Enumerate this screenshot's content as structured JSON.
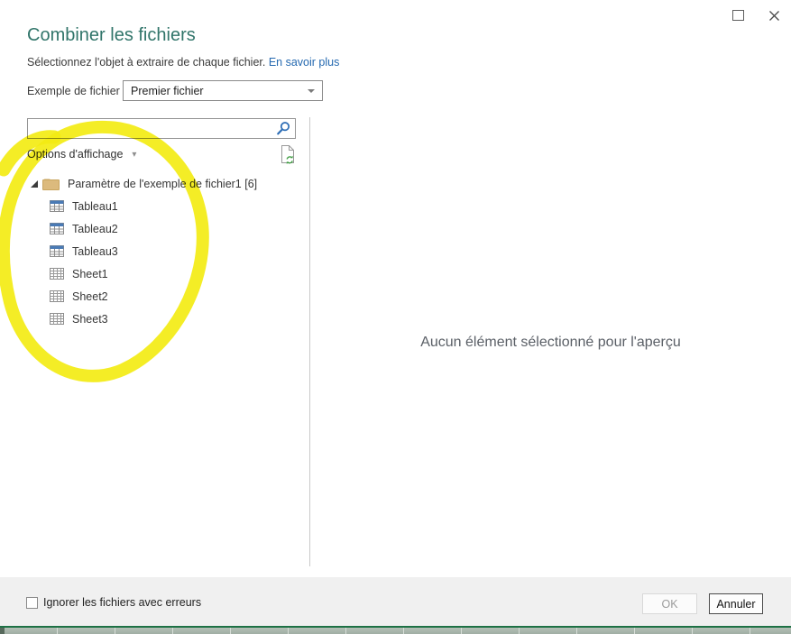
{
  "window": {
    "maximize_icon": "maximize",
    "close_icon": "close"
  },
  "header": {
    "title": "Combiner les fichiers",
    "subtitle": "Sélectionnez l'objet à extraire de chaque fichier.",
    "learn_more_label": "En savoir plus",
    "sample_file_label": "Exemple de fichier :",
    "sample_file_value": "Premier fichier"
  },
  "left_panel": {
    "search_placeholder": "",
    "display_options_label": "Options d'affichage",
    "refresh_icon": "refresh-document-icon",
    "search_icon": "search-icon",
    "tree": {
      "root_label": "Paramètre de l'exemple de fichier1 [6]",
      "root_icon": "folder-icon",
      "root_expanded": true,
      "items": [
        {
          "label": "Tableau1",
          "icon": "table-icon"
        },
        {
          "label": "Tableau2",
          "icon": "table-icon"
        },
        {
          "label": "Tableau3",
          "icon": "table-icon"
        },
        {
          "label": "Sheet1",
          "icon": "worksheet-icon"
        },
        {
          "label": "Sheet2",
          "icon": "worksheet-icon"
        },
        {
          "label": "Sheet3",
          "icon": "worksheet-icon"
        }
      ]
    }
  },
  "preview_panel": {
    "empty_message": "Aucun élément sélectionné pour l'aperçu"
  },
  "footer": {
    "ignore_errors_label": "Ignorer les fichiers avec erreurs",
    "ignore_errors_checked": false,
    "ok_label": "OK",
    "ok_enabled": false,
    "cancel_label": "Annuler"
  },
  "annotation": {
    "type": "hand-drawn-ellipse-highlighter",
    "color": "#f3ec13"
  },
  "colors": {
    "title": "#31756a",
    "link": "#2569b0",
    "excel_green": "#1e7145",
    "footer_bg": "#f0f0f0",
    "table_icon_header": "#4a7ab5"
  }
}
